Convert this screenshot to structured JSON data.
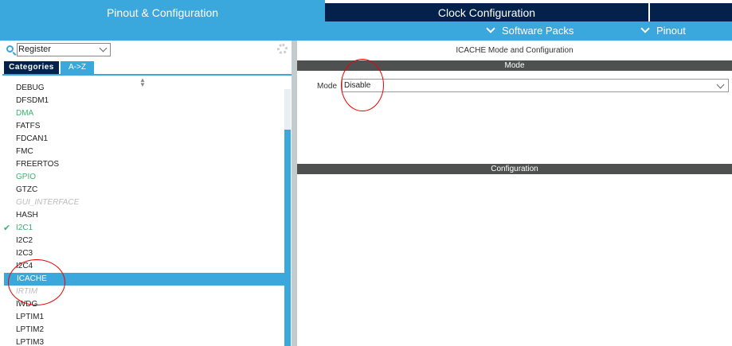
{
  "tabs": {
    "pinout": "Pinout & Configuration",
    "clock": "Clock Configuration"
  },
  "menus": {
    "software_packs": "Software Packs",
    "pinout": "Pinout"
  },
  "search": {
    "value": "Register"
  },
  "view_tabs": {
    "categories": "Categories",
    "az": "A->Z"
  },
  "list": [
    {
      "label": "DEBUG",
      "state": "normal"
    },
    {
      "label": "DFSDM1",
      "state": "normal"
    },
    {
      "label": "DMA",
      "state": "green"
    },
    {
      "label": "FATFS",
      "state": "normal"
    },
    {
      "label": "FDCAN1",
      "state": "normal"
    },
    {
      "label": "FMC",
      "state": "normal"
    },
    {
      "label": "FREERTOS",
      "state": "normal"
    },
    {
      "label": "GPIO",
      "state": "green"
    },
    {
      "label": "GTZC",
      "state": "normal"
    },
    {
      "label": "GUI_INTERFACE",
      "state": "disabled"
    },
    {
      "label": "HASH",
      "state": "normal"
    },
    {
      "label": "I2C1",
      "state": "green-checked"
    },
    {
      "label": "I2C2",
      "state": "normal"
    },
    {
      "label": "I2C3",
      "state": "normal"
    },
    {
      "label": "I2C4",
      "state": "normal"
    },
    {
      "label": "ICACHE",
      "state": "selected"
    },
    {
      "label": "IRTIM",
      "state": "disabled"
    },
    {
      "label": "IWDG",
      "state": "normal"
    },
    {
      "label": "LPTIM1",
      "state": "normal"
    },
    {
      "label": "LPTIM2",
      "state": "normal"
    },
    {
      "label": "LPTIM3",
      "state": "normal"
    }
  ],
  "right": {
    "title": "ICACHE Mode and Configuration",
    "mode_section": "Mode",
    "mode_label": "Mode",
    "mode_value": "Disable",
    "config_section": "Configuration"
  }
}
